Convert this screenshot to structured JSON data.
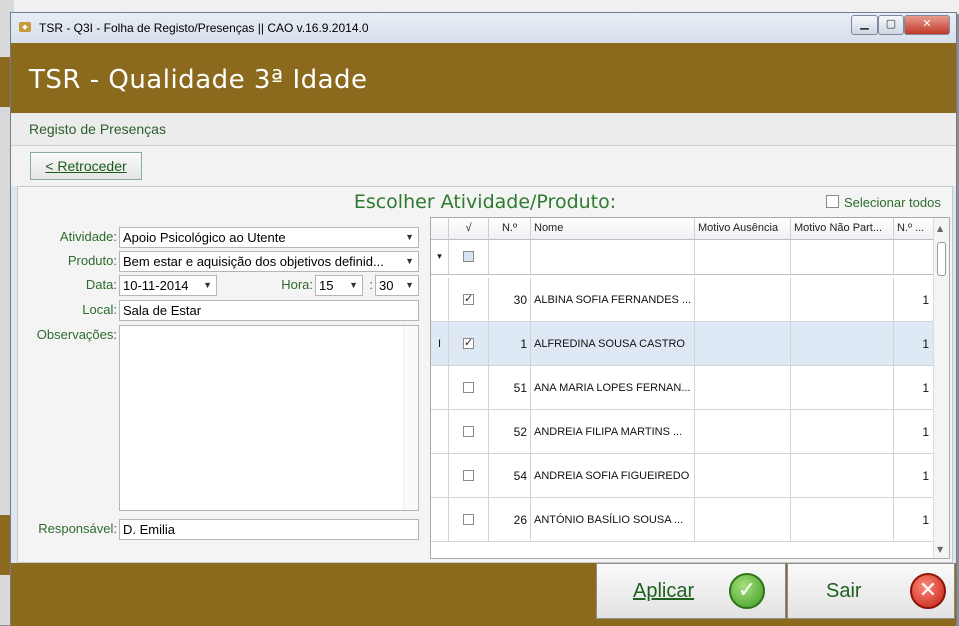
{
  "window": {
    "title": "TSR - Q3I - Folha de Registo/Presenças || CAO   v.16.9.2014.0",
    "icon": "app-icon"
  },
  "header": {
    "title": "TSR - Qualidade 3ª Idade"
  },
  "section": {
    "title": "Registo de Presenças"
  },
  "nav": {
    "back_label": "< Retroceder"
  },
  "main": {
    "title": "Escolher Atividade/Produto:",
    "select_all_label": "Selecionar todos"
  },
  "form": {
    "atividade_label": "Atividade:",
    "atividade_value": "Apoio Psicológico ao Utente",
    "produto_label": "Produto:",
    "produto_value": "Bem estar e aquisição dos objetivos definid...",
    "data_label": "Data:",
    "data_value": "10-11-2014",
    "hora_label": "Hora:",
    "hora_value": "15",
    "minuto_sep": ":",
    "minuto_value": "30",
    "local_label": "Local:",
    "local_value": "Sala de Estar",
    "observacoes_label": "Observações:",
    "responsavel_label": "Responsável:",
    "responsavel_value": "D. Emilia"
  },
  "grid": {
    "headers": {
      "check": "√",
      "num": "N.º",
      "nome": "Nome",
      "motivo_ausencia": "Motivo Ausência",
      "motivo_nao_part": "Motivo Não Part...",
      "num2": "N.º ..."
    },
    "rows": [
      {
        "checked": true,
        "num": "30",
        "nome": "ALBINA SOFIA FERNANDES ...",
        "num2": "1"
      },
      {
        "checked": true,
        "num": "1",
        "nome": "ALFREDINA SOUSA CASTRO",
        "num2": "1"
      },
      {
        "checked": false,
        "num": "51",
        "nome": "ANA MARIA LOPES FERNAN...",
        "num2": "1"
      },
      {
        "checked": false,
        "num": "52",
        "nome": "ANDREIA FILIPA MARTINS ...",
        "num2": "1"
      },
      {
        "checked": false,
        "num": "54",
        "nome": "ANDREIA SOFIA FIGUEIREDO",
        "num2": "1"
      },
      {
        "checked": false,
        "num": "26",
        "nome": "ANTÓNIO BASÍLIO SOUSA ...",
        "num2": "1"
      }
    ]
  },
  "footer": {
    "apply_label": "Aplicar",
    "exit_label": "Sair"
  },
  "colors": {
    "brand": "#8B6A1E",
    "label_green": "#2e6b2e",
    "selected_row": "#dfe9f5"
  }
}
